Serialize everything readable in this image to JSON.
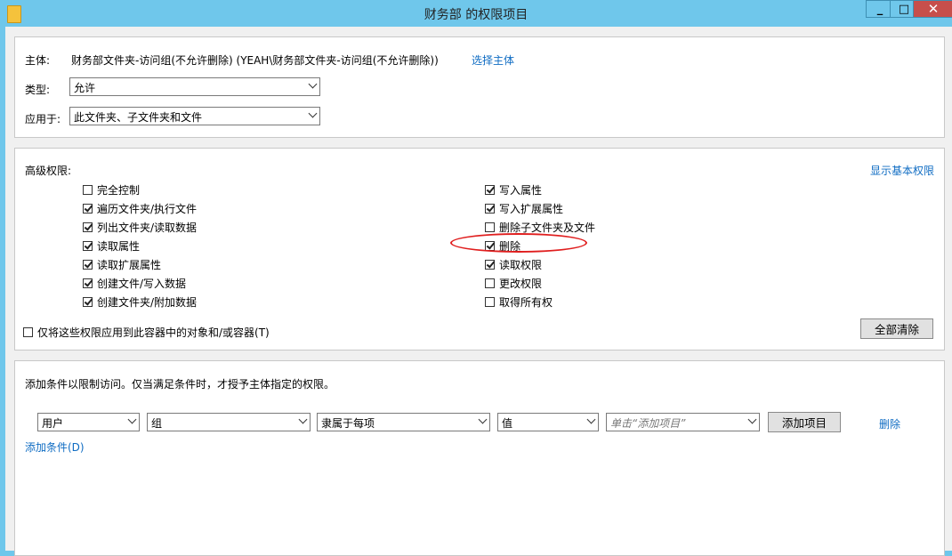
{
  "window": {
    "title": "财务部 的权限项目",
    "controls": [
      "_",
      "□",
      "✕"
    ]
  },
  "principal": {
    "label": "主体:",
    "value": "财务部文件夹-访问组(不允许删除) (YEAH\\财务部文件夹-访问组(不允许删除))",
    "select_link": "选择主体"
  },
  "type": {
    "label": "类型:",
    "value": "允许"
  },
  "applies_to": {
    "label": "应用于:",
    "value": "此文件夹、子文件夹和文件"
  },
  "advanced": {
    "label": "高级权限:",
    "show_basic_link": "显示基本权限",
    "left": [
      {
        "label": "完全控制",
        "checked": false
      },
      {
        "label": "遍历文件夹/执行文件",
        "checked": true
      },
      {
        "label": "列出文件夹/读取数据",
        "checked": true
      },
      {
        "label": "读取属性",
        "checked": true
      },
      {
        "label": "读取扩展属性",
        "checked": true
      },
      {
        "label": "创建文件/写入数据",
        "checked": true
      },
      {
        "label": "创建文件夹/附加数据",
        "checked": true
      }
    ],
    "right": [
      {
        "label": "写入属性",
        "checked": true
      },
      {
        "label": "写入扩展属性",
        "checked": true
      },
      {
        "label": "删除子文件夹及文件",
        "checked": false
      },
      {
        "label": "删除",
        "checked": true
      },
      {
        "label": "读取权限",
        "checked": true
      },
      {
        "label": "更改权限",
        "checked": false
      },
      {
        "label": "取得所有权",
        "checked": false
      }
    ],
    "apply_only_label": "仅将这些权限应用到此容器中的对象和/或容器(T)",
    "apply_only_checked": false,
    "clear_all": "全部清除",
    "highlight_color": "#e01e1e"
  },
  "conditions": {
    "description": "添加条件以限制访问。仅当满足条件时，才授予主体指定的权限。",
    "row": {
      "s1": "用户",
      "s2": "组",
      "s3": "隶属于每项",
      "s4": "值",
      "s5_placeholder": "单击“添加项目”",
      "add_item": "添加项目",
      "delete": "删除"
    },
    "add_condition": "添加条件(D)"
  }
}
